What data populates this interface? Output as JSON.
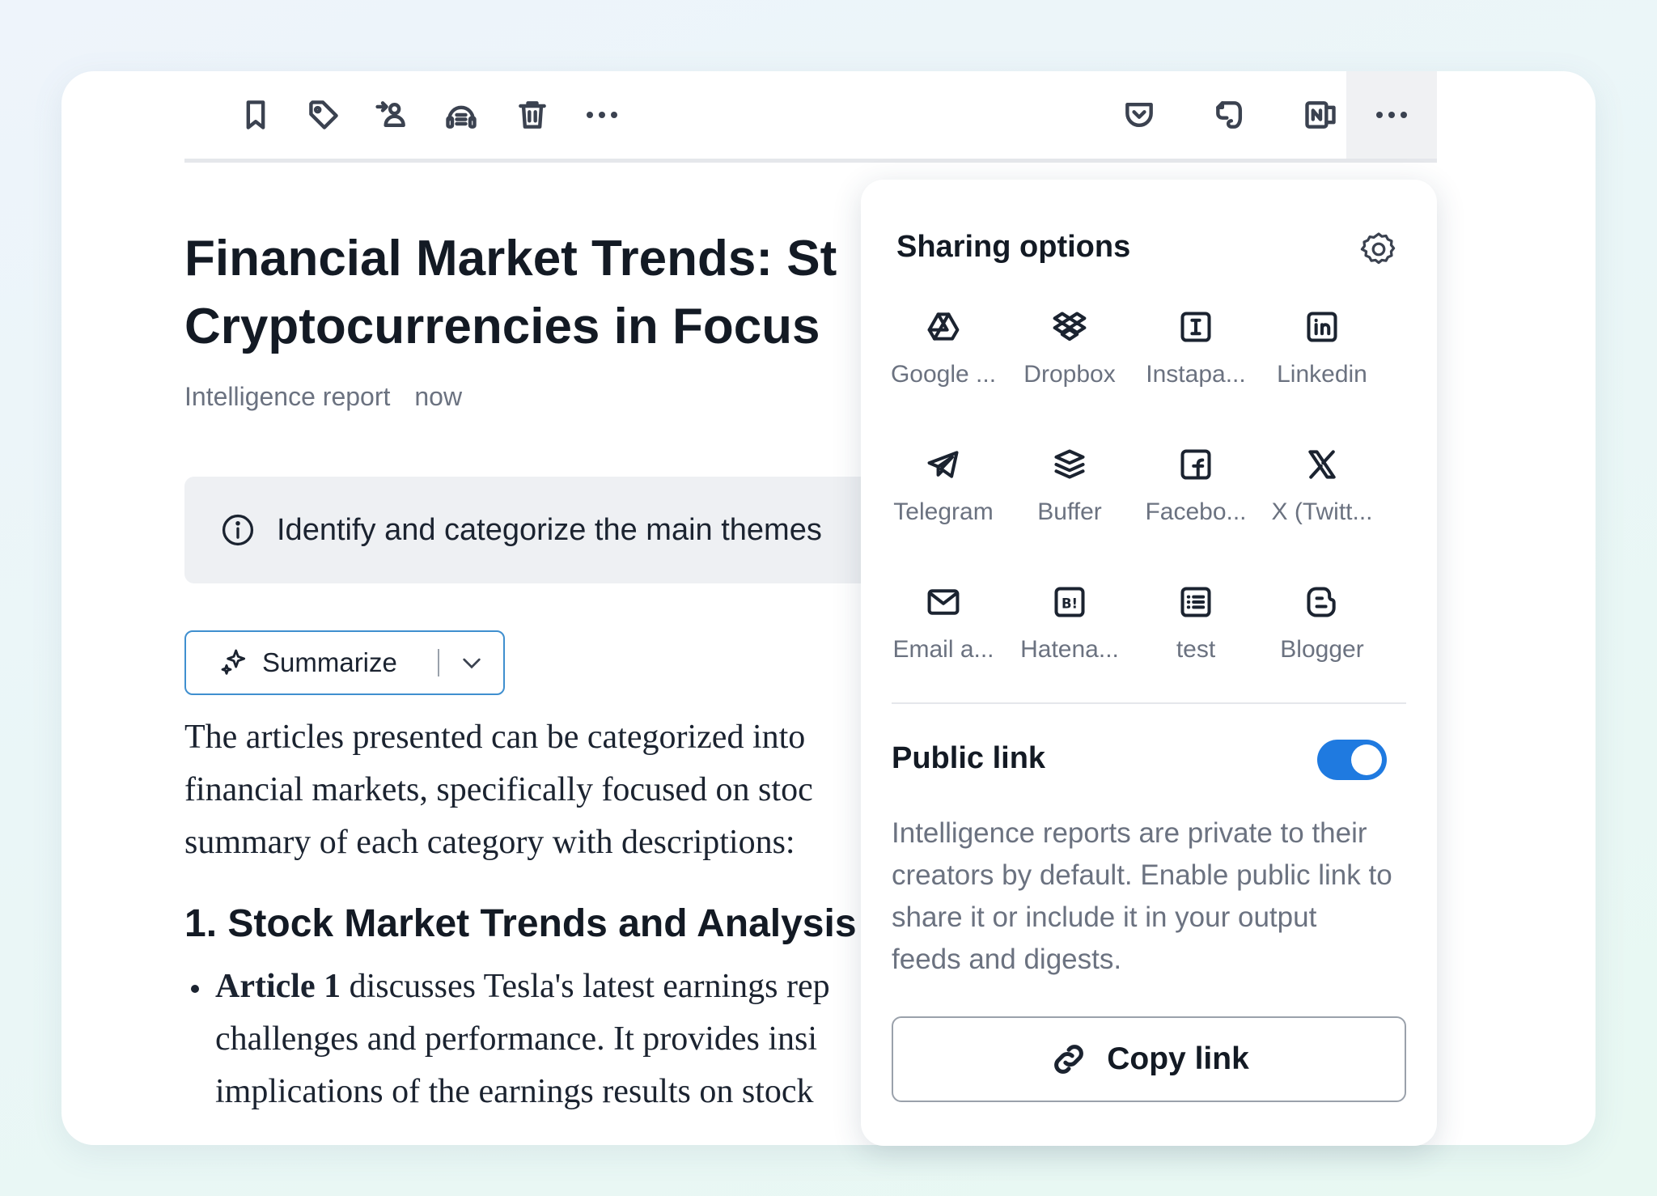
{
  "toolbar": {
    "left_icons": [
      "bookmark-icon",
      "tag-icon",
      "share-users-icon",
      "podcast-icon",
      "trash-icon",
      "more-icon"
    ],
    "right_icons": [
      "pocket-icon",
      "evernote-icon",
      "onenote-icon",
      "more-active-icon"
    ]
  },
  "article": {
    "title_line1": "Financial Market Trends: St",
    "title_line2": "Cryptocurrencies in Focus",
    "source": "Intelligence report",
    "time": "now",
    "prompt": "Identify and categorize the main themes",
    "summarize_label": "Summarize",
    "body_lines": [
      "The articles presented can be categorized into",
      "financial markets, specifically focused on stoc",
      "summary of each category with descriptions:"
    ],
    "section_heading": "1. Stock Market Trends and Analysis",
    "bullet_bold": "Article 1",
    "bullet_line1_rest": " discusses Tesla's latest earnings rep",
    "bullet_line2": "challenges and performance. It provides insi",
    "bullet_line3": "implications of the earnings results on stock"
  },
  "sharing": {
    "title": "Sharing options",
    "services": [
      {
        "label": "Google ...",
        "icon": "google-drive-icon"
      },
      {
        "label": "Dropbox",
        "icon": "dropbox-icon"
      },
      {
        "label": "Instapa...",
        "icon": "instapaper-icon"
      },
      {
        "label": "Linkedin",
        "icon": "linkedin-icon"
      },
      {
        "label": "Telegram",
        "icon": "telegram-icon"
      },
      {
        "label": "Buffer",
        "icon": "buffer-icon"
      },
      {
        "label": "Facebo...",
        "icon": "facebook-icon"
      },
      {
        "label": "X (Twitt...",
        "icon": "x-twitter-icon"
      },
      {
        "label": "Email a...",
        "icon": "email-icon"
      },
      {
        "label": "Hatena...",
        "icon": "hatena-icon"
      },
      {
        "label": "test",
        "icon": "list-icon"
      },
      {
        "label": "Blogger",
        "icon": "blogger-icon"
      }
    ],
    "public_link_title": "Public link",
    "public_link_enabled": true,
    "public_link_desc": "Intelligence reports are private to their creators by default. Enable public link to share it or include it in your output feeds and digests.",
    "copy_link_label": "Copy link",
    "accent": "#1f7ae0"
  }
}
